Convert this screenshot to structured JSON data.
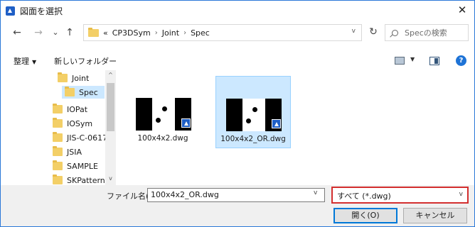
{
  "window": {
    "title": "図面を選択",
    "close_glyph": "✕",
    "app_icon": "app-icon-triangle"
  },
  "nav": {
    "back_glyph": "←",
    "forward_glyph": "→",
    "recent_glyph": "⌄",
    "up_glyph": "↑",
    "refresh_glyph": "↻",
    "breadcrumb_overflow": "«",
    "breadcrumbs": [
      "CP3DSym",
      "Joint",
      "Spec"
    ],
    "separator": "›",
    "search_placeholder": "Specの検索"
  },
  "toolbar": {
    "organize_label": "整理",
    "organize_caret": "▼",
    "new_folder_label": "新しいフォルダー",
    "view_caret": "▼",
    "help_label": "?"
  },
  "tree": {
    "items": [
      {
        "label": "Joint"
      },
      {
        "label": "Spec",
        "selected": true
      },
      {
        "label": "IOPat"
      },
      {
        "label": "IOSym"
      },
      {
        "label": "JIS-C-0617"
      },
      {
        "label": "JSIA"
      },
      {
        "label": "SAMPLE"
      },
      {
        "label": "SKPatterns"
      }
    ],
    "scroll_up_glyph": "^",
    "scroll_down_glyph": "v"
  },
  "files": [
    {
      "name": "100x4x2.dwg",
      "selected": false
    },
    {
      "name": "100x4x2_OR.dwg",
      "selected": true
    }
  ],
  "bottom": {
    "filename_label": "ファイル名(N):",
    "filename_value": "100x4x2_OR.dwg",
    "dropdown_glyph": "v",
    "filter_value": "すべて (*.dwg)",
    "open_label": "開く(O)",
    "cancel_label": "キャンセル"
  },
  "colors": {
    "accent": "#0078d7",
    "selection": "#cce8ff",
    "highlight_border": "#d32f2f",
    "folder": "#f3cf67"
  }
}
